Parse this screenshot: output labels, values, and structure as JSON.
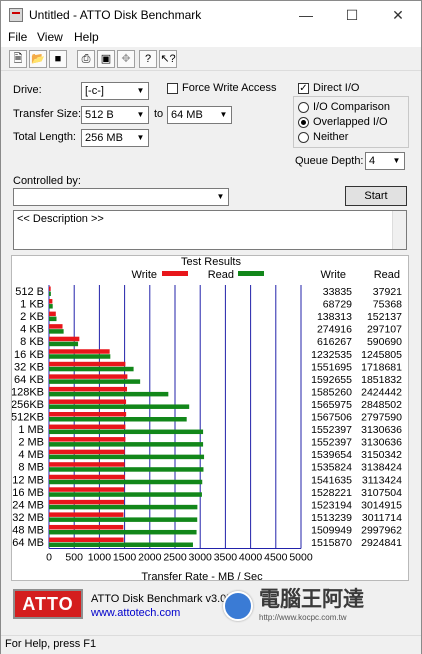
{
  "window": {
    "title": "Untitled - ATTO Disk Benchmark"
  },
  "menu": [
    "File",
    "View",
    "Help"
  ],
  "toolbar_icons": [
    "new-file-icon",
    "open-folder-icon",
    "save-icon",
    "print-icon",
    "print-preview-icon",
    "move-icon",
    "help-icon",
    "context-help-icon"
  ],
  "settings": {
    "drive_label": "Drive:",
    "drive_value": "[-c-]",
    "transfer_size_label": "Transfer Size:",
    "transfer_from": "512 B",
    "to_label": "to",
    "transfer_to": "64 MB",
    "total_length_label": "Total Length:",
    "total_length_value": "256 MB",
    "force_write_label": "Force Write Access",
    "direct_io_label": "Direct I/O",
    "io_comparison_label": "I/O Comparison",
    "overlapped_io_label": "Overlapped I/O",
    "neither_label": "Neither",
    "queue_depth_label": "Queue Depth:",
    "queue_depth_value": "4",
    "controlled_by_label": "Controlled by:",
    "start_label": "Start",
    "description": "<< Description >>"
  },
  "results": {
    "title": "Test Results",
    "write_label": "Write",
    "read_label": "Read",
    "col_write": "Write",
    "col_read": "Read",
    "write_color": "#e8161b",
    "read_color": "#12871a"
  },
  "chart_data": {
    "type": "bar",
    "title": "Test Results",
    "xlabel": "Transfer Rate - MB / Sec",
    "xlim": [
      0,
      5000
    ],
    "xticks": [
      "0",
      "500",
      "1000",
      "1500",
      "2000",
      "2500",
      "3000",
      "3500",
      "4000",
      "4500",
      "5000"
    ],
    "categories": [
      "512 B",
      "1 KB",
      "2 KB",
      "4 KB",
      "8 KB",
      "16 KB",
      "32 KB",
      "64 KB",
      "128KB",
      "256KB",
      "512KB",
      "1 MB",
      "2 MB",
      "4 MB",
      "8 MB",
      "12 MB",
      "16 MB",
      "24 MB",
      "32 MB",
      "48 MB",
      "64 MB"
    ],
    "series": [
      {
        "name": "Write",
        "values": [
          33835,
          68729,
          138313,
          274916,
          616267,
          1232535,
          1551695,
          1592655,
          1585260,
          1565975,
          1567506,
          1552397,
          1552397,
          1539654,
          1535824,
          1541635,
          1528221,
          1523194,
          1513239,
          1509949,
          1515870
        ]
      },
      {
        "name": "Read",
        "values": [
          37921,
          75368,
          152137,
          297107,
          590690,
          1245805,
          1718681,
          1851832,
          2424442,
          2848502,
          2797590,
          3130636,
          3130636,
          3150342,
          3138424,
          3113424,
          3107504,
          3014915,
          3011714,
          2997962,
          2924841
        ]
      }
    ],
    "legend": "top",
    "grid": true
  },
  "footer": {
    "logo": "ATTO",
    "product": "ATTO Disk Benchmark v3.05",
    "url": "www.attotech.com"
  },
  "watermark": {
    "name": "電腦王阿達",
    "url": "http://www.kocpc.com.tw"
  },
  "status": "For Help, press F1"
}
